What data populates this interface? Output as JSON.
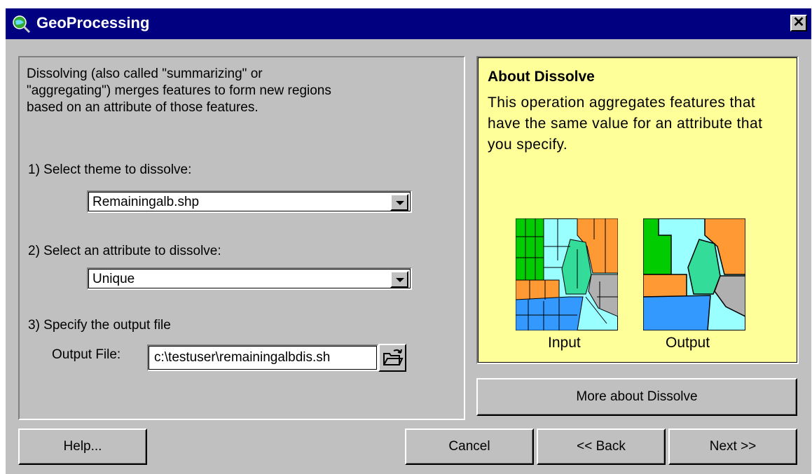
{
  "window": {
    "title": "GeoProcessing",
    "close_label": "✕"
  },
  "left": {
    "intro": "Dissolving (also called \"summarizing\" or \"aggregating\") merges features to form new regions based on an attribute of those features.",
    "step1_label": "1) Select theme to dissolve:",
    "theme_value": "Remainingalb.shp",
    "step2_label": "2) Select an attribute to dissolve:",
    "attribute_value": "Unique",
    "step3_label": "3) Specify the output file",
    "output_label": "Output File:",
    "output_value": "c:\\testuser\\remainingalbdis.sh"
  },
  "info": {
    "title": "About Dissolve",
    "body": "This operation aggregates features that have the same value for an attribute that you specify.",
    "input_caption": "Input",
    "output_caption": "Output",
    "colors": {
      "green": "#00cc00",
      "cyan": "#99ffff",
      "orange": "#ff9933",
      "blue": "#3399ff",
      "gray": "#b0b0b0",
      "mint": "#33dd99"
    }
  },
  "buttons": {
    "more_about": "More about Dissolve",
    "help": "Help...",
    "cancel": "Cancel",
    "back": "<< Back",
    "next": "Next >>"
  }
}
